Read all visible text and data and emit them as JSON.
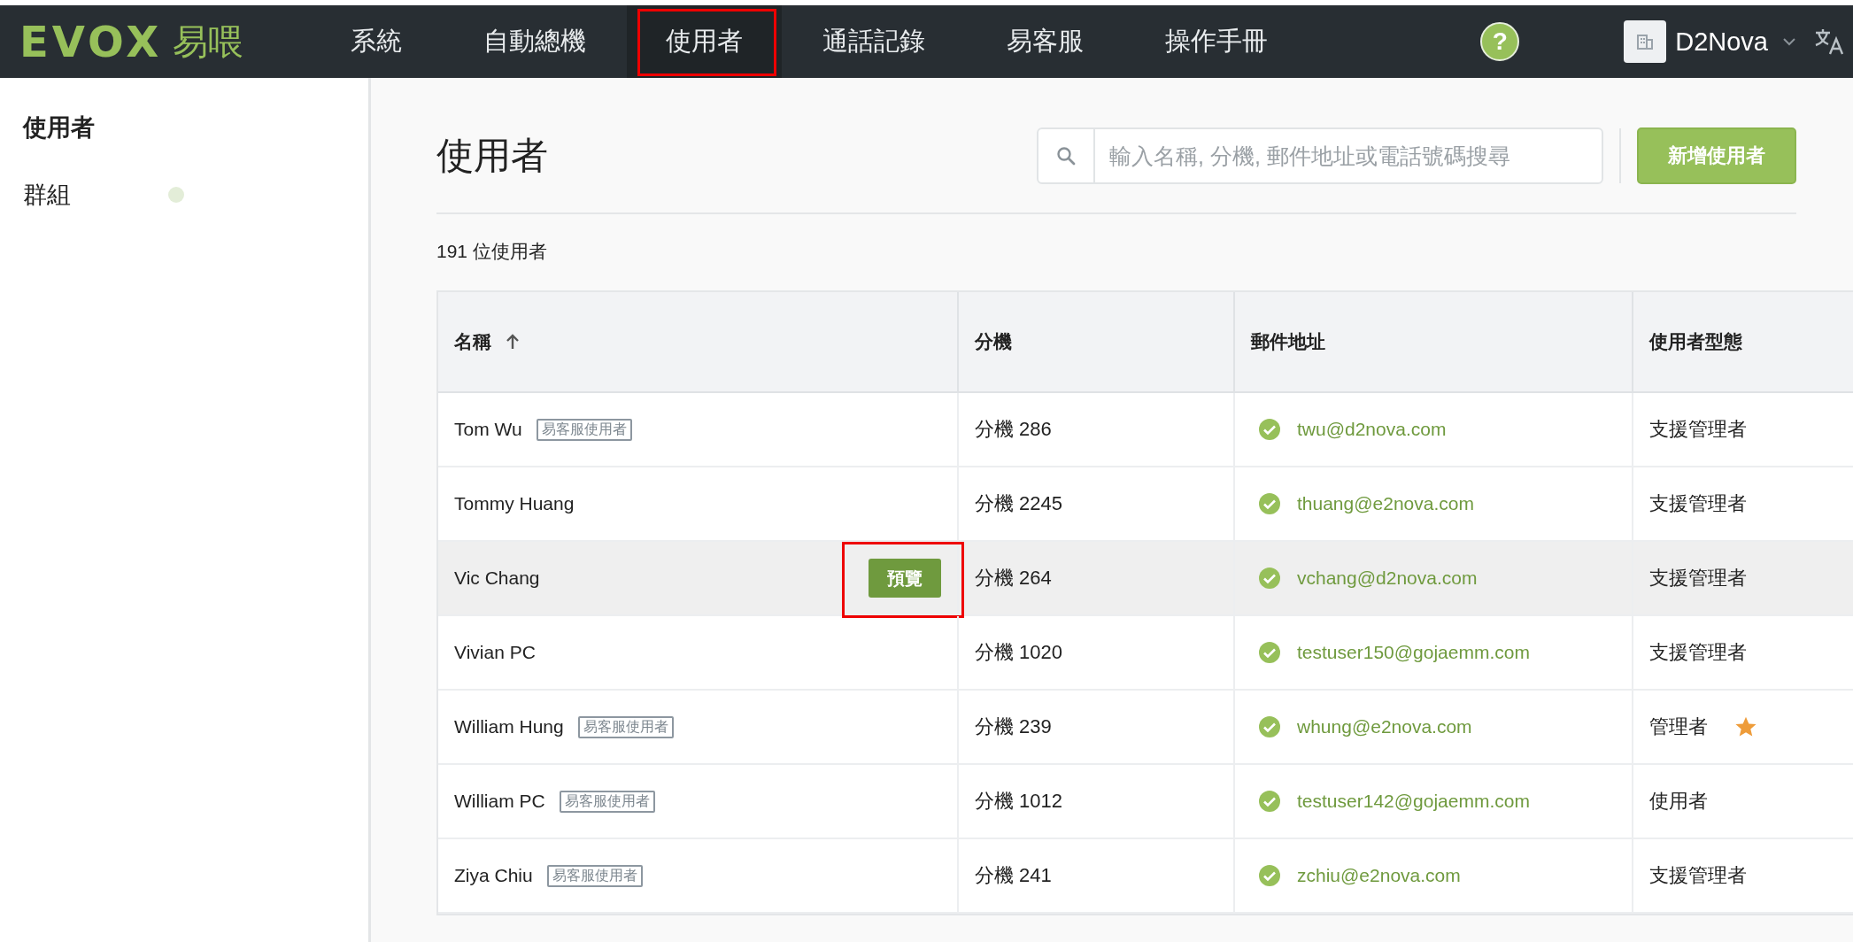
{
  "logo": {
    "mark": "EVOX",
    "name": "易喂"
  },
  "nav": [
    {
      "label": "系統",
      "selected": false,
      "highlighted": false
    },
    {
      "label": "自動總機",
      "selected": false,
      "highlighted": false
    },
    {
      "label": "使用者",
      "selected": true,
      "highlighted": true
    },
    {
      "label": "通話記錄",
      "selected": false,
      "highlighted": false
    },
    {
      "label": "易客服",
      "selected": false,
      "highlighted": false
    },
    {
      "label": "操作手冊",
      "selected": false,
      "highlighted": false
    }
  ],
  "header": {
    "help": "?",
    "account": "D2Nova"
  },
  "sidebar": {
    "items": [
      {
        "label": "使用者",
        "selected": true
      },
      {
        "label": "群組",
        "selected": false
      }
    ]
  },
  "page": {
    "title": "使用者",
    "search": {
      "placeholder": "輸入名稱, 分機, 郵件地址或電話號碼搜尋"
    },
    "add_button": "新增使用者",
    "count": "191 位使用者"
  },
  "table": {
    "columns": [
      {
        "label": "名稱",
        "sorted": true
      },
      {
        "label": "分機",
        "sorted": false
      },
      {
        "label": "郵件地址",
        "sorted": false
      },
      {
        "label": "使用者型態",
        "sorted": false
      }
    ],
    "rows": [
      {
        "name": "Tom Wu",
        "tag": "易客服使用者",
        "extension": "分機 286",
        "verified": true,
        "email": "twu@d2nova.com",
        "type": "支援管理者",
        "starred": false,
        "hovered": false
      },
      {
        "name": "Tommy Huang",
        "extension": "分機 2245",
        "verified": true,
        "email": "thuang@e2nova.com",
        "type": "支援管理者",
        "starred": false,
        "hovered": false
      },
      {
        "name": "Vic Chang",
        "preview_button": "預覽",
        "preview_highlighted": true,
        "extension": "分機 264",
        "verified": true,
        "email": "vchang@d2nova.com",
        "type": "支援管理者",
        "starred": false,
        "hovered": true
      },
      {
        "name": "Vivian PC",
        "extension": "分機 1020",
        "verified": true,
        "email": "testuser150@gojaemm.com",
        "type": "支援管理者",
        "starred": false,
        "hovered": false
      },
      {
        "name": "William Hung",
        "tag": "易客服使用者",
        "extension": "分機 239",
        "verified": true,
        "email": "whung@e2nova.com",
        "type": "管理者",
        "starred": true,
        "hovered": false
      },
      {
        "name": "William PC",
        "tag": "易客服使用者",
        "extension": "分機 1012",
        "verified": true,
        "email": "testuser142@gojaemm.com",
        "type": "使用者",
        "starred": false,
        "hovered": false
      },
      {
        "name": "Ziya Chiu",
        "tag": "易客服使用者",
        "extension": "分機 241",
        "verified": true,
        "email": "zchiu@e2nova.com",
        "type": "支援管理者",
        "starred": false,
        "hovered": false
      }
    ]
  }
}
